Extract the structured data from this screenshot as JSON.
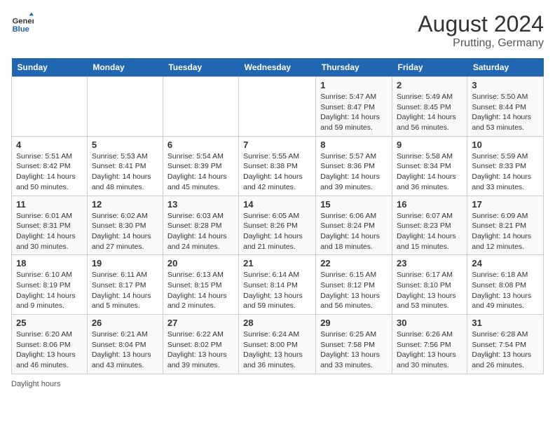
{
  "header": {
    "logo_general": "General",
    "logo_blue": "Blue",
    "title": "August 2024",
    "subtitle": "Prutting, Germany"
  },
  "days_of_week": [
    "Sunday",
    "Monday",
    "Tuesday",
    "Wednesday",
    "Thursday",
    "Friday",
    "Saturday"
  ],
  "weeks": [
    [
      {
        "day": "",
        "info": ""
      },
      {
        "day": "",
        "info": ""
      },
      {
        "day": "",
        "info": ""
      },
      {
        "day": "",
        "info": ""
      },
      {
        "day": "1",
        "info": "Sunrise: 5:47 AM\nSunset: 8:47 PM\nDaylight: 14 hours\nand 59 minutes."
      },
      {
        "day": "2",
        "info": "Sunrise: 5:49 AM\nSunset: 8:45 PM\nDaylight: 14 hours\nand 56 minutes."
      },
      {
        "day": "3",
        "info": "Sunrise: 5:50 AM\nSunset: 8:44 PM\nDaylight: 14 hours\nand 53 minutes."
      }
    ],
    [
      {
        "day": "4",
        "info": "Sunrise: 5:51 AM\nSunset: 8:42 PM\nDaylight: 14 hours\nand 50 minutes."
      },
      {
        "day": "5",
        "info": "Sunrise: 5:53 AM\nSunset: 8:41 PM\nDaylight: 14 hours\nand 48 minutes."
      },
      {
        "day": "6",
        "info": "Sunrise: 5:54 AM\nSunset: 8:39 PM\nDaylight: 14 hours\nand 45 minutes."
      },
      {
        "day": "7",
        "info": "Sunrise: 5:55 AM\nSunset: 8:38 PM\nDaylight: 14 hours\nand 42 minutes."
      },
      {
        "day": "8",
        "info": "Sunrise: 5:57 AM\nSunset: 8:36 PM\nDaylight: 14 hours\nand 39 minutes."
      },
      {
        "day": "9",
        "info": "Sunrise: 5:58 AM\nSunset: 8:34 PM\nDaylight: 14 hours\nand 36 minutes."
      },
      {
        "day": "10",
        "info": "Sunrise: 5:59 AM\nSunset: 8:33 PM\nDaylight: 14 hours\nand 33 minutes."
      }
    ],
    [
      {
        "day": "11",
        "info": "Sunrise: 6:01 AM\nSunset: 8:31 PM\nDaylight: 14 hours\nand 30 minutes."
      },
      {
        "day": "12",
        "info": "Sunrise: 6:02 AM\nSunset: 8:30 PM\nDaylight: 14 hours\nand 27 minutes."
      },
      {
        "day": "13",
        "info": "Sunrise: 6:03 AM\nSunset: 8:28 PM\nDaylight: 14 hours\nand 24 minutes."
      },
      {
        "day": "14",
        "info": "Sunrise: 6:05 AM\nSunset: 8:26 PM\nDaylight: 14 hours\nand 21 minutes."
      },
      {
        "day": "15",
        "info": "Sunrise: 6:06 AM\nSunset: 8:24 PM\nDaylight: 14 hours\nand 18 minutes."
      },
      {
        "day": "16",
        "info": "Sunrise: 6:07 AM\nSunset: 8:23 PM\nDaylight: 14 hours\nand 15 minutes."
      },
      {
        "day": "17",
        "info": "Sunrise: 6:09 AM\nSunset: 8:21 PM\nDaylight: 14 hours\nand 12 minutes."
      }
    ],
    [
      {
        "day": "18",
        "info": "Sunrise: 6:10 AM\nSunset: 8:19 PM\nDaylight: 14 hours\nand 9 minutes."
      },
      {
        "day": "19",
        "info": "Sunrise: 6:11 AM\nSunset: 8:17 PM\nDaylight: 14 hours\nand 5 minutes."
      },
      {
        "day": "20",
        "info": "Sunrise: 6:13 AM\nSunset: 8:15 PM\nDaylight: 14 hours\nand 2 minutes."
      },
      {
        "day": "21",
        "info": "Sunrise: 6:14 AM\nSunset: 8:14 PM\nDaylight: 13 hours\nand 59 minutes."
      },
      {
        "day": "22",
        "info": "Sunrise: 6:15 AM\nSunset: 8:12 PM\nDaylight: 13 hours\nand 56 minutes."
      },
      {
        "day": "23",
        "info": "Sunrise: 6:17 AM\nSunset: 8:10 PM\nDaylight: 13 hours\nand 53 minutes."
      },
      {
        "day": "24",
        "info": "Sunrise: 6:18 AM\nSunset: 8:08 PM\nDaylight: 13 hours\nand 49 minutes."
      }
    ],
    [
      {
        "day": "25",
        "info": "Sunrise: 6:20 AM\nSunset: 8:06 PM\nDaylight: 13 hours\nand 46 minutes."
      },
      {
        "day": "26",
        "info": "Sunrise: 6:21 AM\nSunset: 8:04 PM\nDaylight: 13 hours\nand 43 minutes."
      },
      {
        "day": "27",
        "info": "Sunrise: 6:22 AM\nSunset: 8:02 PM\nDaylight: 13 hours\nand 39 minutes."
      },
      {
        "day": "28",
        "info": "Sunrise: 6:24 AM\nSunset: 8:00 PM\nDaylight: 13 hours\nand 36 minutes."
      },
      {
        "day": "29",
        "info": "Sunrise: 6:25 AM\nSunset: 7:58 PM\nDaylight: 13 hours\nand 33 minutes."
      },
      {
        "day": "30",
        "info": "Sunrise: 6:26 AM\nSunset: 7:56 PM\nDaylight: 13 hours\nand 30 minutes."
      },
      {
        "day": "31",
        "info": "Sunrise: 6:28 AM\nSunset: 7:54 PM\nDaylight: 13 hours\nand 26 minutes."
      }
    ]
  ],
  "footer": {
    "note": "Daylight hours"
  }
}
